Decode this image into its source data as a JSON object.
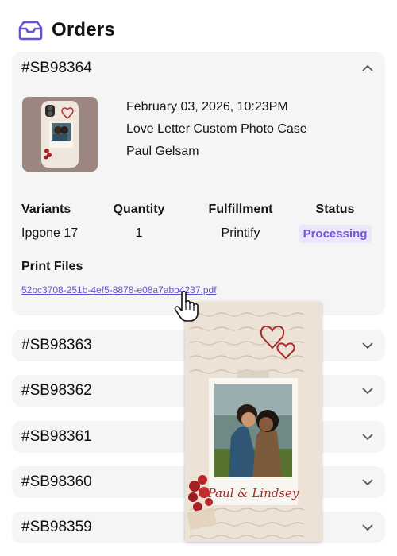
{
  "page": {
    "title": "Orders",
    "icon": "inbox-icon"
  },
  "orders": [
    {
      "id": "#SB98364",
      "expanded": true,
      "date": "February 03, 2026, 10:23PM",
      "product": "Love Letter Custom Photo Case",
      "customer": "Paul Gelsam",
      "headers": {
        "variants": "Variants",
        "quantity": "Quantity",
        "fulfillment": "Fulfillment",
        "status": "Status"
      },
      "values": {
        "variants": "Ipgone 17",
        "quantity": "1",
        "fulfillment": "Printify",
        "status": "Processing"
      },
      "print_files_label": "Print Files",
      "print_file": "52bc3708-251b-4ef5-8878-e08a7abb4237.pdf"
    },
    {
      "id": "#SB98363",
      "expanded": false
    },
    {
      "id": "#SB98362",
      "expanded": false
    },
    {
      "id": "#SB98361",
      "expanded": false
    },
    {
      "id": "#SB98360",
      "expanded": false
    },
    {
      "id": "#SB98359",
      "expanded": false
    }
  ],
  "preview": {
    "caption": "Paul & Lindsey"
  },
  "colors": {
    "accent": "#6b50d3",
    "status_bg": "#ebe6fb",
    "status_text": "#7058d6",
    "link": "#6257d0",
    "card_bg": "#f5f5f5"
  }
}
